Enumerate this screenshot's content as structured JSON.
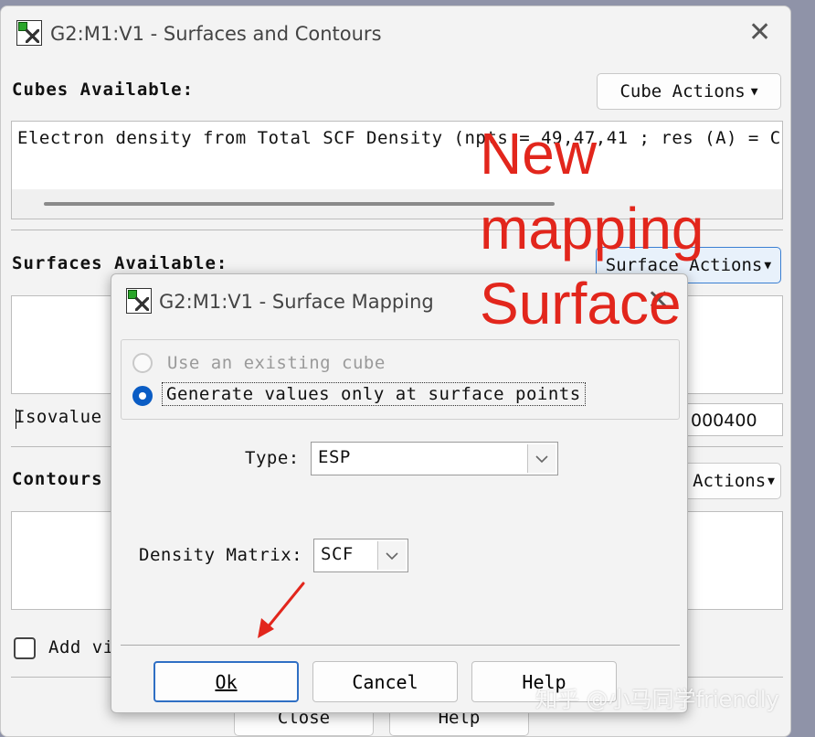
{
  "main_window": {
    "title": "G2:M1:V1 - Surfaces and Contours",
    "cubes_label": "Cubes Available:",
    "cube_actions_label": "Cube Actions",
    "cube_entry": "Electron density from Total SCF Density (npts = 49,47,41 ; res (A) = C",
    "surfaces_label": "Surfaces Available:",
    "surface_actions_label": "Surface Actions",
    "isovalue_label": "Isovalue",
    "isovalue_value": "000400",
    "contours_label": "Contours",
    "contour_actions_label": "Actions",
    "add_checkbox_label": "Add vi",
    "bottom_left_button": "Close",
    "bottom_right_button": "Help"
  },
  "dialog": {
    "title": "G2:M1:V1 - Surface Mapping",
    "option_existing": "Use an existing cube",
    "option_generate": "Generate values only at surface points",
    "selected_option": "Generate values only at surface points",
    "type_label": "Type:",
    "type_value": "ESP",
    "density_label": "Density Matrix:",
    "density_value": "SCF",
    "ok_label": "Ok",
    "cancel_label": "Cancel",
    "help_label": "Help"
  },
  "annotation": {
    "lines": [
      "New",
      "mapping",
      "Surface"
    ],
    "color": "#e2261c"
  },
  "watermark": "知乎 @小马同学friendly",
  "colors": {
    "background": "#8f93a8",
    "window": "#f3f3f3",
    "accent": "#0a5cc4"
  }
}
